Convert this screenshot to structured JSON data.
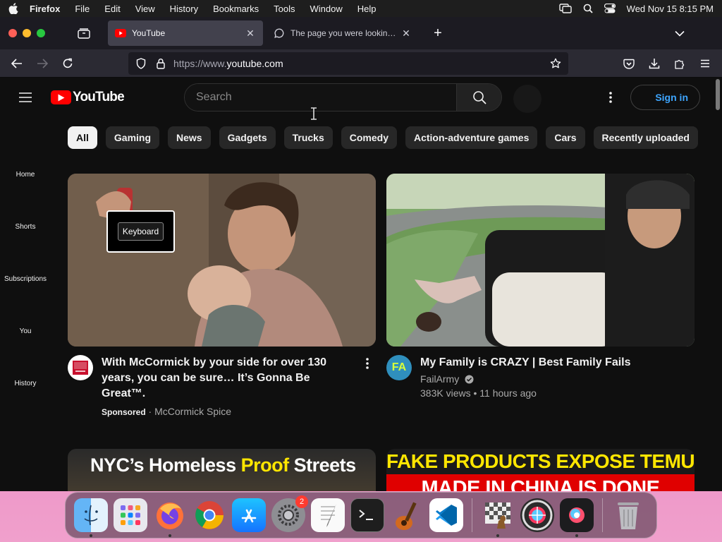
{
  "menubar": {
    "app": "Firefox",
    "items": [
      "File",
      "Edit",
      "View",
      "History",
      "Bookmarks",
      "Tools",
      "Window",
      "Help"
    ],
    "clock": "Wed Nov 15  8:15 PM"
  },
  "browser": {
    "tabs": [
      {
        "title": "YouTube",
        "icon": "youtube-favicon"
      },
      {
        "title": "The page you were looking for d",
        "icon": "chat-bubble-icon"
      }
    ],
    "url_protocol": "https://www.",
    "url_host": "youtube.com"
  },
  "youtube": {
    "logo_text": "YouTube",
    "search_placeholder": "Search",
    "sign_in": "Sign in",
    "chips": [
      "All",
      "Gaming",
      "News",
      "Gadgets",
      "Trucks",
      "Comedy",
      "Action-adventure games",
      "Cars",
      "Recently uploaded"
    ],
    "guide": [
      "Home",
      "Shorts",
      "Subscriptions",
      "You",
      "History"
    ],
    "keyboard_badge": "Keyboard",
    "videos": [
      {
        "title": "With McCormick by your side for over 130 years, you can be sure… It’s Gonna Be Great™.",
        "sponsored": "Sponsored",
        "channel": "McCormick Spice"
      },
      {
        "title": "My Family is CRAZY | Best Family Fails",
        "channel": "FailArmy",
        "stats": "383K views • 11 hours ago",
        "avatar_text": "FA"
      }
    ],
    "bottom_thumbs": [
      {
        "text_a": "NYC’s Homeless ",
        "text_b": "Proof",
        "text_c": " Streets"
      },
      {
        "line1": "FAKE PRODUCTS EXPOSE TEMU",
        "line2": "MADE IN CHINA IS DONE"
      }
    ]
  },
  "dock": {
    "apps": [
      "finder",
      "launchpad",
      "firefox",
      "chrome",
      "app-store",
      "system-settings",
      "textedit",
      "terminal",
      "garageband",
      "vscode",
      "chess",
      "pixelmator",
      "siri-app",
      "trash"
    ],
    "settings_badge": "2"
  },
  "colors": {
    "yt_red": "#ff0000",
    "link_blue": "#3ea6ff",
    "yt_bg": "#0f0f0f"
  }
}
